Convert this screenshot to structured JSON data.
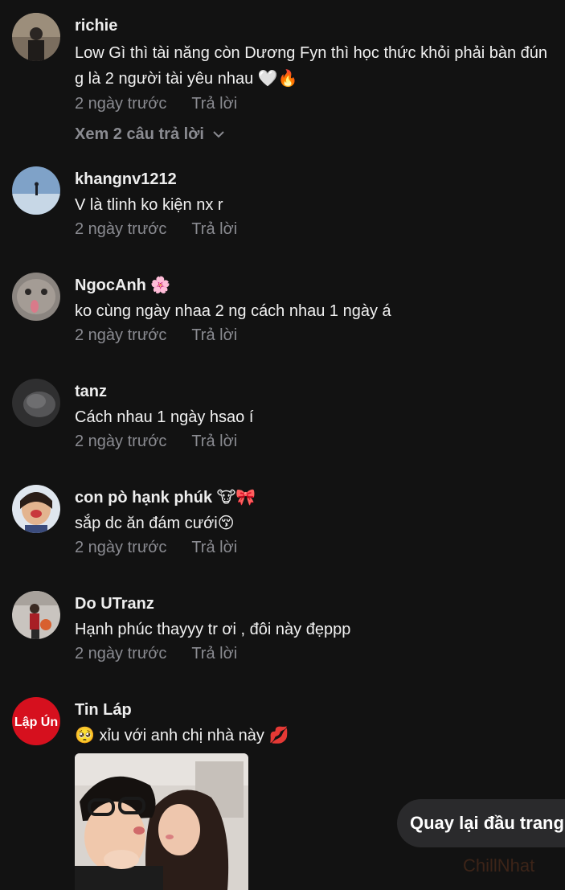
{
  "comments": [
    {
      "username": "richie",
      "text": "Low Gì thì tài năng còn Dương Fyn thì học thức khỏi phải bàn đúng là 2 người tài yêu nhau 🤍🔥",
      "time": "2 ngày trước",
      "reply_label": "Trả lời",
      "view_replies": "Xem 2 câu trả lời"
    },
    {
      "username": "khangnv1212",
      "text": "V là tlinh ko kiện nx r",
      "time": "2 ngày trước",
      "reply_label": "Trả lời"
    },
    {
      "username": "NgocAnh 🌸",
      "text": "ko cùng ngày nhaa 2 ng cách nhau 1 ngày á",
      "time": "2 ngày trước",
      "reply_label": "Trả lời"
    },
    {
      "username": "tanz",
      "text": "Cách nhau 1 ngày hsao í",
      "time": "2 ngày trước",
      "reply_label": "Trả lời"
    },
    {
      "username": "con pò hạnk phúk 🐮🎀",
      "text": "sắp dc ăn đám cưới😚",
      "time": "2 ngày trước",
      "reply_label": "Trả lời"
    },
    {
      "username": "Do UTranz",
      "text": "Hạnh phúc thayyy tr ơi , đôi này đẹppp",
      "time": "2 ngày trước",
      "reply_label": "Trả lời"
    },
    {
      "username": "Tin Láp",
      "text": "🥺 xỉu với anh chị nhà này 💋",
      "avatar_logo": "Lập Ún",
      "has_photo": true
    }
  ],
  "back_to_top": "Quay lại đầu trang",
  "watermark": "ChillNhat"
}
